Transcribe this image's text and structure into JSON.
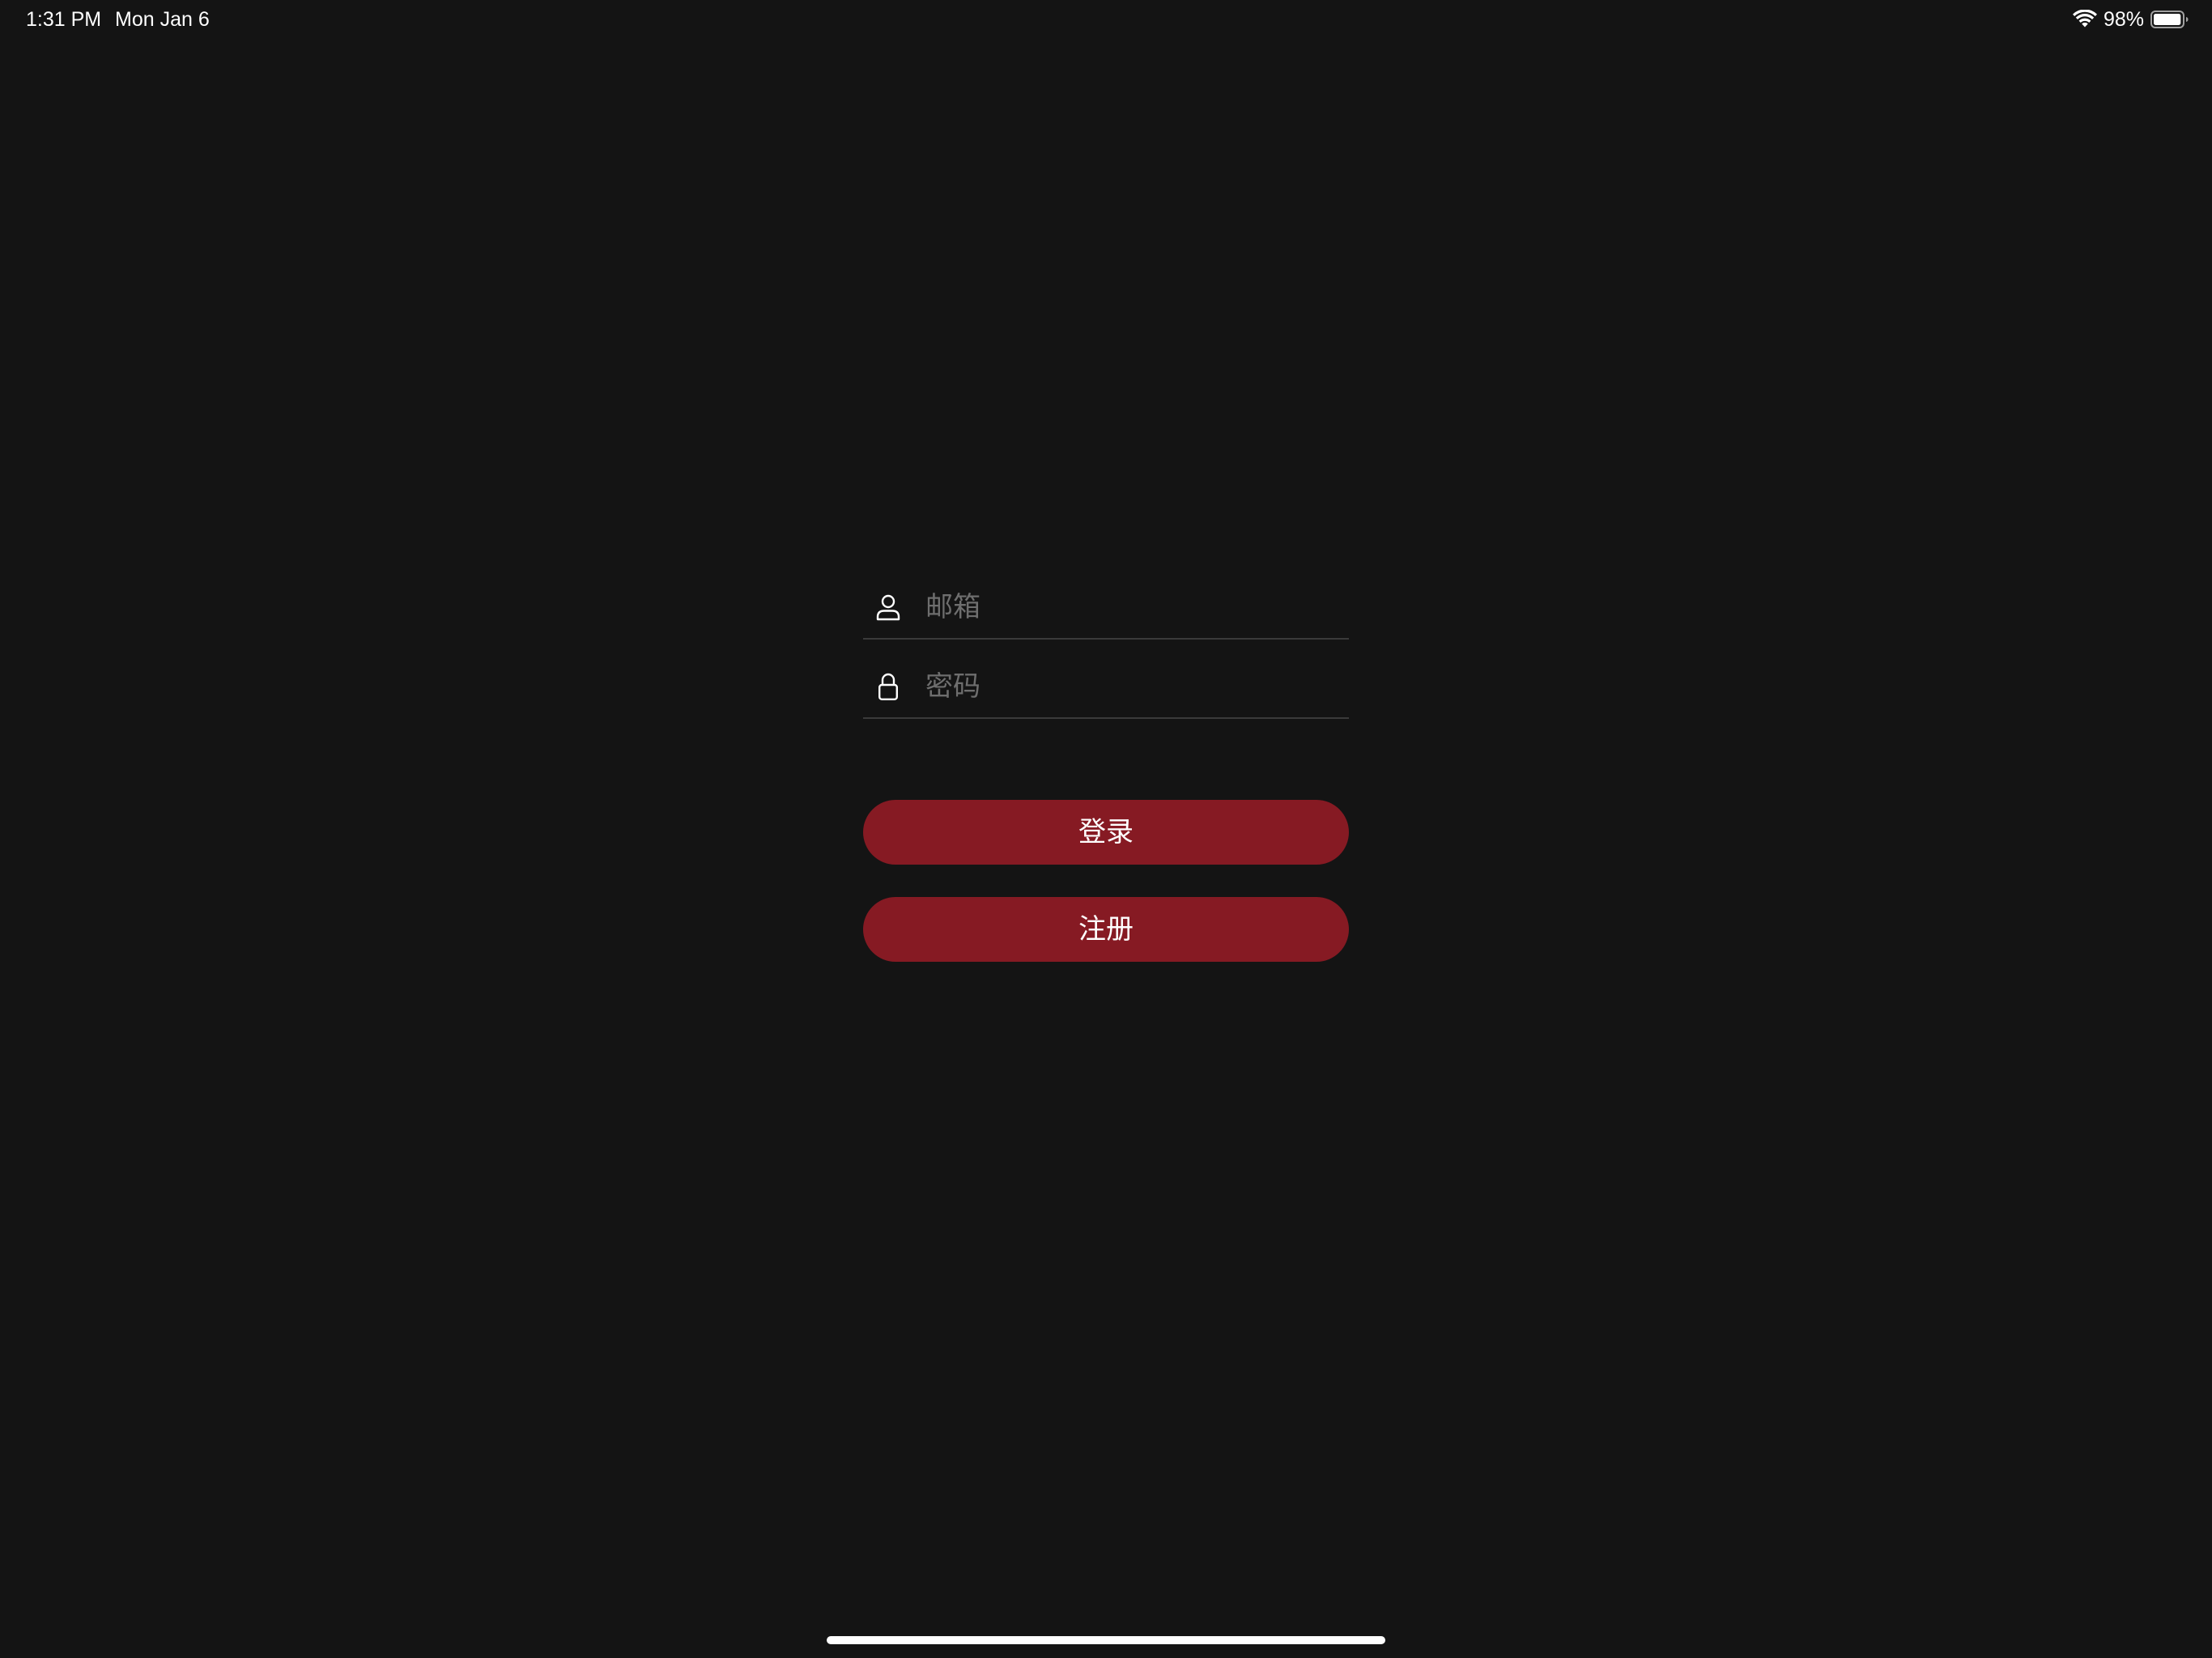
{
  "status_bar": {
    "time": "1:31 PM",
    "date": "Mon Jan 6",
    "battery_percent": "98%",
    "battery_level": 0.98,
    "icons": [
      "wifi-icon",
      "battery-icon"
    ]
  },
  "login": {
    "email": {
      "icon": "person-icon",
      "placeholder": "邮箱",
      "value": ""
    },
    "password": {
      "icon": "lock-icon",
      "placeholder": "密码",
      "value": ""
    },
    "login_label": "登录",
    "register_label": "注册"
  },
  "colors": {
    "background": "#141414",
    "accent": "#861a23",
    "divider": "#3a3a3a",
    "placeholder": "#6e6e6e"
  }
}
